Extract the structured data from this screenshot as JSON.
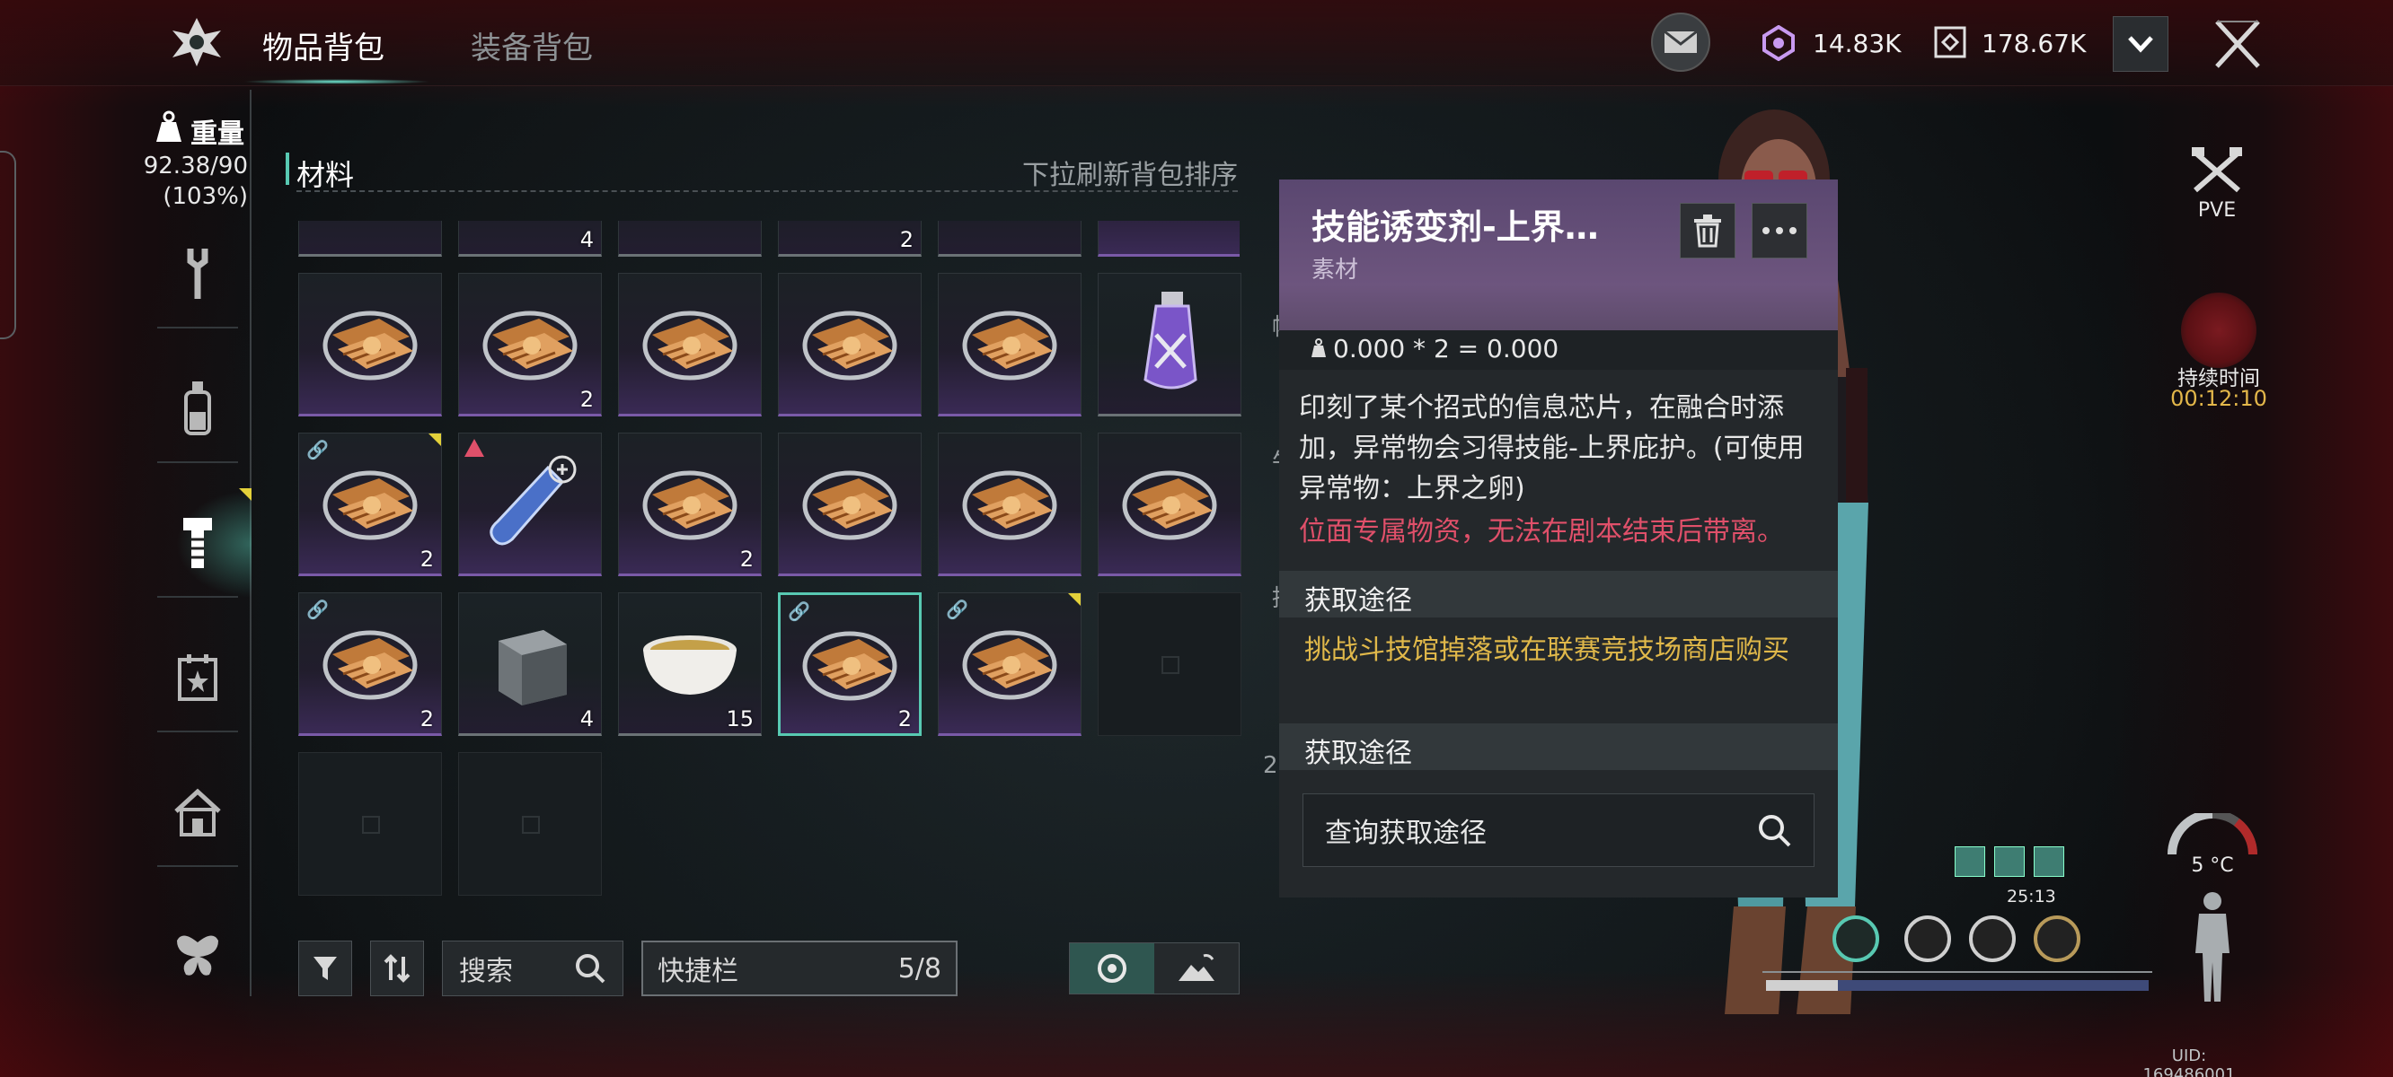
{
  "tabs": [
    {
      "label": "物品背包"
    },
    {
      "label": "装备背包"
    }
  ],
  "currencies": {
    "gem": "14.83K",
    "coin": "178.67K"
  },
  "weight": {
    "label": "重量",
    "value": "92.38/90",
    "percent": "(103%)"
  },
  "category": {
    "title": "材料",
    "refresh_hint": "下拉刷新背包排序"
  },
  "top_partial_counts": [
    "4",
    "2"
  ],
  "grid": [
    [
      {
        "icon": "chip",
        "count": ""
      },
      {
        "icon": "chip",
        "count": "2"
      },
      {
        "icon": "chip",
        "count": ""
      },
      {
        "icon": "chip",
        "count": ""
      },
      {
        "icon": "chip",
        "count": ""
      },
      {
        "icon": "vial-purple",
        "count": ""
      }
    ],
    [
      {
        "icon": "chip",
        "count": "2"
      },
      {
        "icon": "test-tube",
        "count": ""
      },
      {
        "icon": "chip",
        "count": "2"
      },
      {
        "icon": "chip",
        "count": ""
      },
      {
        "icon": "chip",
        "count": ""
      },
      {
        "icon": "chip",
        "count": ""
      }
    ],
    [
      {
        "icon": "chip",
        "count": "2"
      },
      {
        "icon": "metal-cube",
        "count": "4"
      },
      {
        "icon": "soup-bowl",
        "count": "15"
      },
      {
        "icon": "chip",
        "count": "2"
      },
      {
        "icon": "chip",
        "count": ""
      },
      {
        "icon": "empty",
        "count": ""
      }
    ]
  ],
  "controls": {
    "search_label": "搜索",
    "quickbar_label": "快捷栏",
    "quickbar_count": "5/8"
  },
  "item": {
    "name": "技能诱变剂-上界…",
    "type": "素材",
    "weight_formula": "0.000 * 2 = 0.000",
    "description": "印刻了某个招式的信息芯片，在融合时添加，异常物会习得技能-上界庇护。(可使用异常物：上界之卵)",
    "warning": "位面专属物资，无法在剧本结束后带离。",
    "section1_title": "获取途径",
    "acquire_text": "挑战斗技馆掉落或在联赛竞技场商店购买",
    "section2_title": "获取途径",
    "query_label": "查询获取途径"
  },
  "hud": {
    "pve_label": "PVE",
    "duration_label": "持续时间",
    "duration_value": "00:12:10",
    "temperature": "5 °C",
    "timer": "25:13",
    "uid": "UID: 169486001",
    "side_peek": [
      "帽",
      "牛",
      "持",
      "2"
    ]
  },
  "colors": {
    "accent": "#58c9b2",
    "warning": "#e0506a",
    "acquire": "#e0b84a",
    "duration": "#e3b74a",
    "rare_border": "#7a5aa8"
  }
}
